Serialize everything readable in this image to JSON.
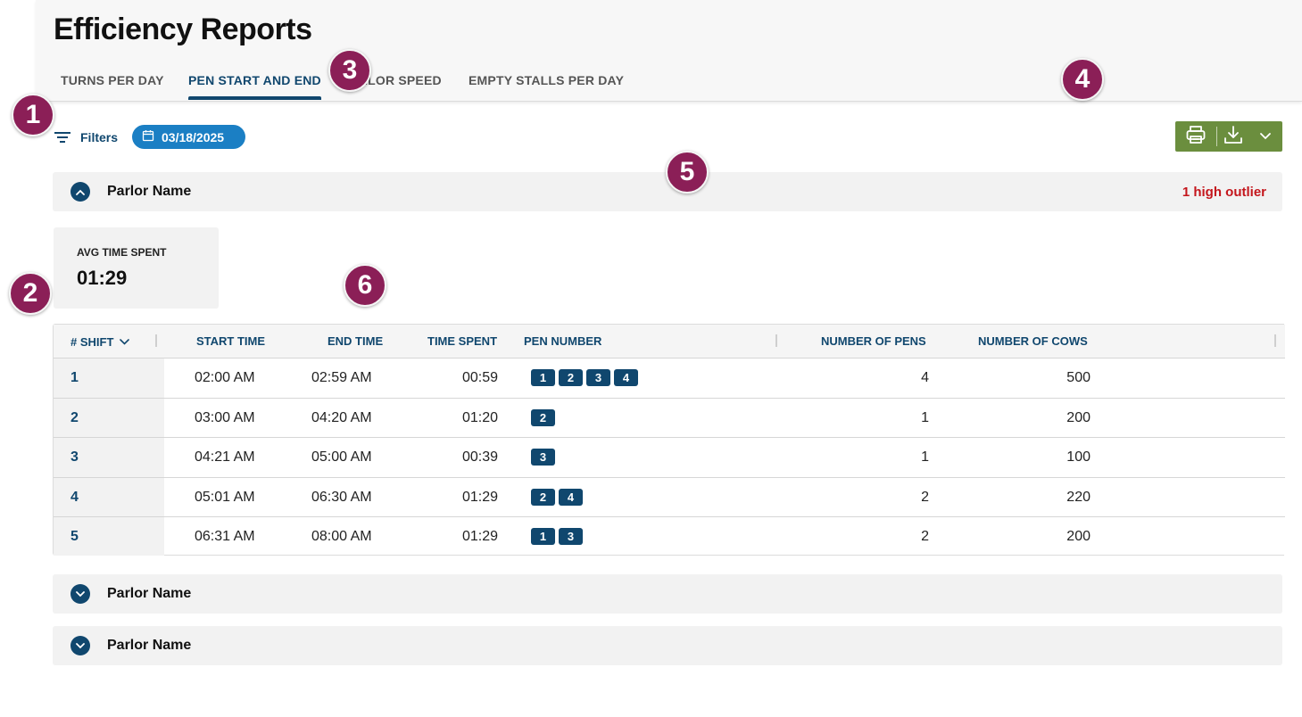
{
  "page": {
    "title": "Efficiency Reports"
  },
  "tabs": [
    {
      "label": "TURNS PER DAY",
      "active": false
    },
    {
      "label": "PEN START AND END",
      "active": true
    },
    {
      "label": "PARLOR SPEED",
      "active": false
    },
    {
      "label": "EMPTY STALLS PER DAY",
      "active": false
    }
  ],
  "filters": {
    "label": "Filters",
    "date": "03/18/2025"
  },
  "export": {
    "print_icon": "printer-icon",
    "download_icon": "download-icon",
    "menu_icon": "chevron-down-icon"
  },
  "sections": [
    {
      "name": "Parlor Name",
      "expanded": true,
      "outlier_text": "1 high outlier"
    },
    {
      "name": "Parlor Name",
      "expanded": false
    },
    {
      "name": "Parlor Name",
      "expanded": false
    }
  ],
  "stat": {
    "label": "AVG TIME SPENT",
    "value": "01:29"
  },
  "table": {
    "headers": {
      "shift": "# SHIFT",
      "start_time": "START TIME",
      "end_time": "END TIME",
      "time_spent": "TIME SPENT",
      "pen_number": "PEN NUMBER",
      "number_of_pens": "NUMBER OF PENS",
      "number_of_cows": "NUMBER OF COWS"
    },
    "rows": [
      {
        "shift": "1",
        "start": "02:00 AM",
        "end": "02:59 AM",
        "spent": "00:59",
        "pens": [
          "1",
          "2",
          "3",
          "4"
        ],
        "num_pens": "4",
        "num_cows": "500"
      },
      {
        "shift": "2",
        "start": "03:00 AM",
        "end": "04:20 AM",
        "spent": "01:20",
        "pens": [
          "2"
        ],
        "num_pens": "1",
        "num_cows": "200"
      },
      {
        "shift": "3",
        "start": "04:21 AM",
        "end": "05:00 AM",
        "spent": "00:39",
        "pens": [
          "3"
        ],
        "num_pens": "1",
        "num_cows": "100"
      },
      {
        "shift": "4",
        "start": "05:01 AM",
        "end": "06:30 AM",
        "spent": "01:29",
        "pens": [
          "2",
          "4"
        ],
        "num_pens": "2",
        "num_cows": "220"
      },
      {
        "shift": "5",
        "start": "06:31 AM",
        "end": "08:00 AM",
        "spent": "01:29",
        "pens": [
          "1",
          "3"
        ],
        "num_pens": "2",
        "num_cows": "200"
      }
    ]
  },
  "markers": [
    "1",
    "2",
    "3",
    "4",
    "5",
    "6"
  ],
  "colors": {
    "primary": "#10476e",
    "chip": "#1b7fc4",
    "export": "#6b8e3e",
    "outlier": "#c4161c",
    "marker": "#8b1f57"
  }
}
